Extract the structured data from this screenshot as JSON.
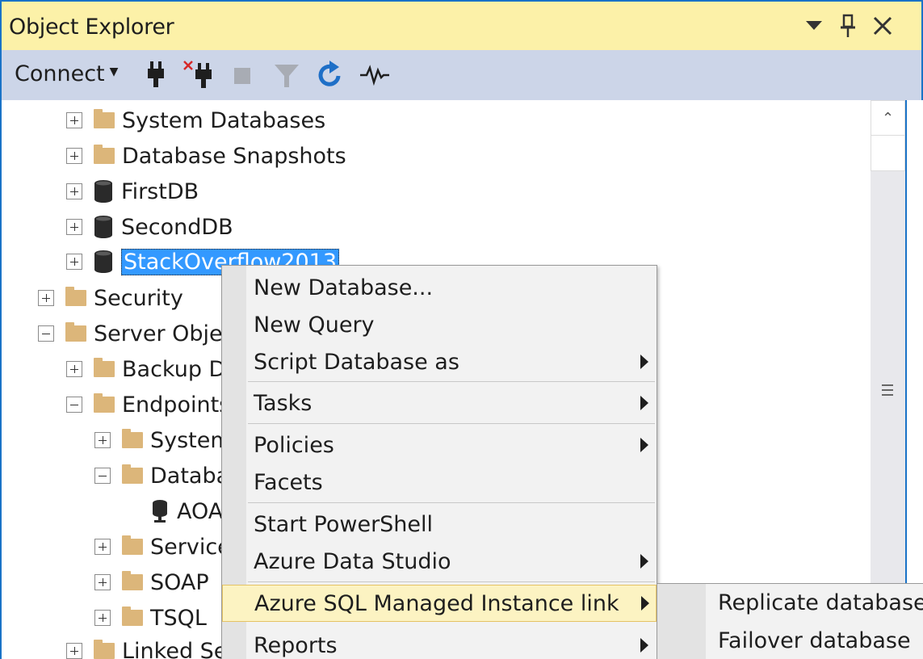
{
  "window": {
    "title": "Object Explorer",
    "dropdown_icon": "chevron-down-icon",
    "pin_icon": "pin-icon",
    "close_icon": "close-icon"
  },
  "toolbar": {
    "connect_label": "Connect",
    "icons": [
      "connect-plug-icon",
      "disconnect-icon",
      "stop-icon",
      "filter-icon",
      "refresh-icon",
      "activity-monitor-icon"
    ]
  },
  "tree": {
    "nodes": [
      {
        "label": "System Databases",
        "icon": "folder-icon",
        "expander": "plus"
      },
      {
        "label": "Database Snapshots",
        "icon": "folder-icon",
        "expander": "plus"
      },
      {
        "label": "FirstDB",
        "icon": "database-icon",
        "expander": "plus"
      },
      {
        "label": "SecondDB",
        "icon": "database-icon",
        "expander": "plus"
      },
      {
        "label": "StackOverflow2013",
        "icon": "database-icon",
        "expander": "plus",
        "selected": true
      },
      {
        "label": "Security",
        "icon": "folder-icon",
        "expander": "plus"
      },
      {
        "label": "Server Objec",
        "icon": "folder-icon",
        "expander": "minus"
      },
      {
        "label": "Backup D",
        "icon": "folder-icon",
        "expander": "plus"
      },
      {
        "label": "Endpoints",
        "icon": "folder-icon",
        "expander": "minus"
      },
      {
        "label": "System",
        "icon": "folder-icon",
        "expander": "plus"
      },
      {
        "label": "Databa",
        "icon": "folder-icon",
        "expander": "minus"
      },
      {
        "label": "AOA",
        "icon": "endpoint-icon",
        "expander": "none"
      },
      {
        "label": "Service",
        "icon": "folder-icon",
        "expander": "plus"
      },
      {
        "label": "SOAP",
        "icon": "folder-icon",
        "expander": "plus"
      },
      {
        "label": "TSQL",
        "icon": "folder-icon",
        "expander": "plus"
      },
      {
        "label": "Linked Se",
        "icon": "folder-icon",
        "expander": "plus"
      }
    ]
  },
  "context_menu": {
    "items": [
      {
        "label": "New Database...",
        "submenu": false
      },
      {
        "label": "New Query",
        "submenu": false
      },
      {
        "label": "Script Database as",
        "submenu": true
      },
      {
        "label": "Tasks",
        "submenu": true
      },
      {
        "label": "Policies",
        "submenu": true
      },
      {
        "label": "Facets",
        "submenu": false
      },
      {
        "label": "Start PowerShell",
        "submenu": false
      },
      {
        "label": "Azure Data Studio",
        "submenu": true
      },
      {
        "label": "Azure SQL Managed Instance link",
        "submenu": true,
        "highlighted": true
      },
      {
        "label": "Reports",
        "submenu": true
      }
    ]
  },
  "submenu": {
    "items": [
      {
        "label": "Replicate database"
      },
      {
        "label": "Failover database"
      }
    ]
  },
  "colors": {
    "title_bar": "#fcf1a8",
    "toolbar": "#ccd5e8",
    "selection": "#3399ff",
    "menu_highlight": "#fcf3c2",
    "folder": "#dcb67a",
    "window_border": "#1a73c7"
  }
}
